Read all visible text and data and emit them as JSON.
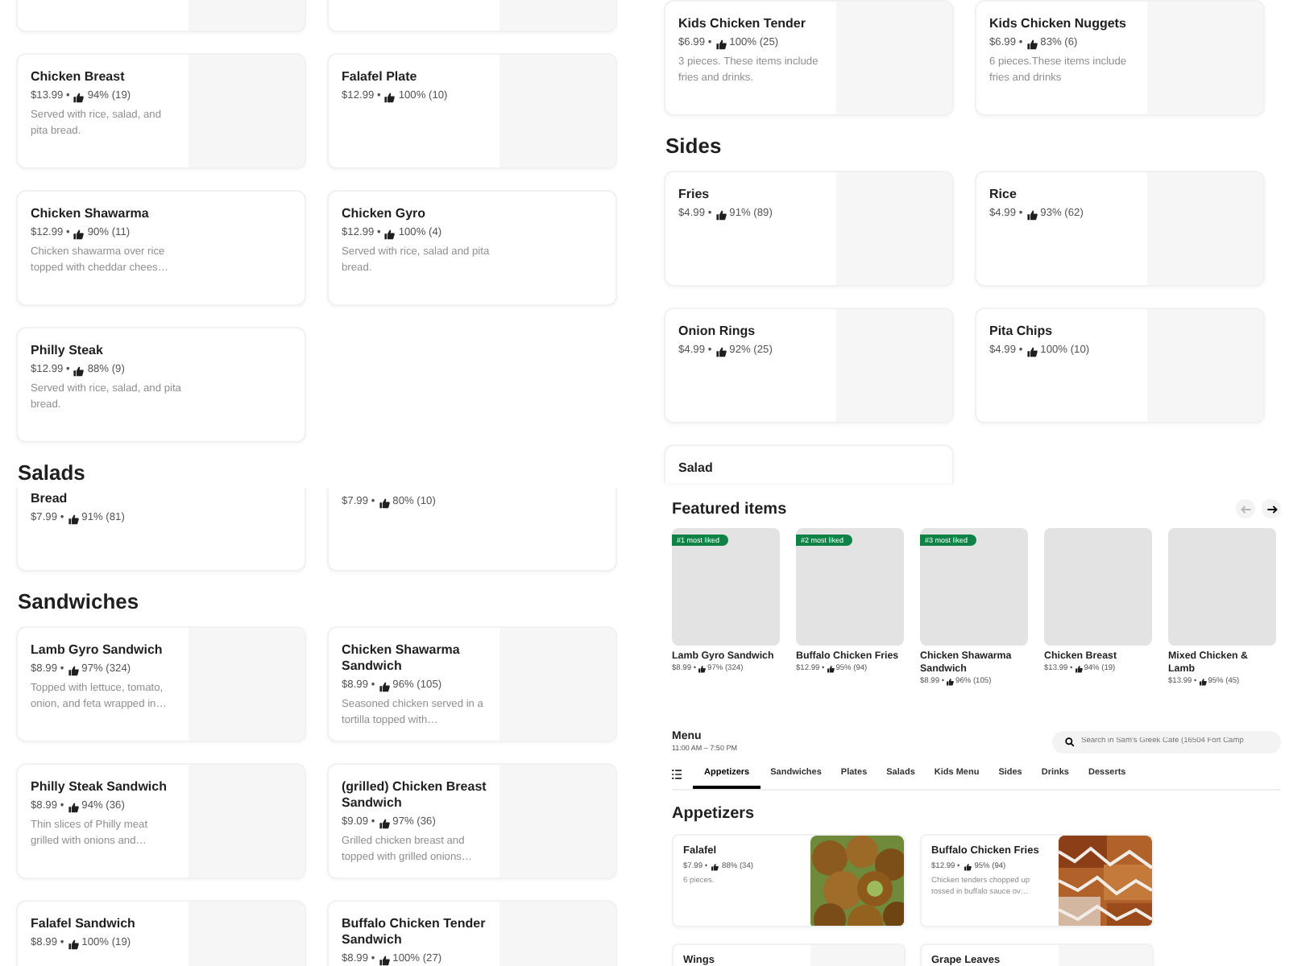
{
  "left_column": {
    "sections": [
      {
        "cards": [
          {
            "kind": "image_card"
          },
          {
            "kind": "image_card"
          },
          {
            "kind": "image_card",
            "title": "Chicken Breast",
            "price": "$13.99 •",
            "rating": "94% (19)",
            "description": "Served with rice, salad, and pita bread."
          },
          {
            "kind": "image_card",
            "title": "Falafel Plate",
            "price": "$12.99 •",
            "rating": "100% (10)"
          },
          {
            "kind": "text_card",
            "title": "Chicken Shawarma",
            "price": "$12.99 •",
            "rating": "90% (11)",
            "description": "Chicken shawarma over rice topped with cheddar chees…"
          },
          {
            "kind": "text_card",
            "title": "Chicken Gyro",
            "price": "$12.99 •",
            "rating": "100% (4)",
            "description": "Served with rice, salad and pita bread."
          },
          {
            "kind": "text_card",
            "title": "Philly Steak",
            "price": "$12.99 •",
            "rating": "88% (9)",
            "description": "Served with rice, salad, and pita bread."
          }
        ]
      },
      {
        "heading": "Salads",
        "cards": [
          {
            "kind": "cut_top",
            "title": "Bread",
            "price": "$7.99 •",
            "rating": "91% (81)"
          },
          {
            "kind": "cut_top",
            "price": "$7.99 •",
            "rating": "80% (10)"
          }
        ]
      },
      {
        "heading": "Sandwiches",
        "cards": [
          {
            "kind": "image_card",
            "title": "Lamb Gyro Sandwich",
            "price": "$8.99 •",
            "rating": "97% (324)",
            "description": "Topped with lettuce, tomato, onion, and feta wrapped in…"
          },
          {
            "kind": "image_card",
            "title": "Chicken Shawarma Sandwich",
            "price": "$8.99 •",
            "rating": "96% (105)",
            "description": "Seasoned chicken served in a tortilla topped with…"
          },
          {
            "kind": "image_card",
            "title": "Philly Steak Sandwich",
            "price": "$8.99 •",
            "rating": "94% (36)",
            "description": "Thin slices of Philly meat grilled with onions and…"
          },
          {
            "kind": "image_card",
            "title": "(grilled) Chicken Breast Sandwich",
            "price": "$9.09 •",
            "rating": "97% (36)",
            "description": "Grilled chicken breast and topped with grilled onions…"
          },
          {
            "kind": "image_card",
            "title": "Falafel Sandwich",
            "price": "$8.99 •",
            "rating": "100% (19)"
          },
          {
            "kind": "image_card",
            "title": "Buffalo Chicken Tender Sandwich",
            "price": "$8.99 •",
            "rating": "100% (27)"
          }
        ]
      }
    ]
  },
  "right_column": {
    "sections": [
      {
        "cards": [
          {
            "kind": "image_card",
            "title": "Kids Chicken Tender",
            "price": "$6.99 •",
            "rating": "100% (25)",
            "description": "3 pieces. These items include fries and drinks."
          },
          {
            "kind": "image_card",
            "title": "Kids Chicken Nuggets",
            "price": "$6.99 •",
            "rating": "83% (6)",
            "description": "6 pieces.These items include fries and drinks"
          }
        ]
      },
      {
        "heading": "Sides",
        "cards": [
          {
            "kind": "image_card",
            "title": "Fries",
            "price": "$4.99 •",
            "rating": "91% (89)"
          },
          {
            "kind": "image_card",
            "title": "Rice",
            "price": "$4.99 •",
            "rating": "93% (62)"
          },
          {
            "kind": "image_card",
            "title": "Onion Rings",
            "price": "$4.99 •",
            "rating": "92% (25)"
          },
          {
            "kind": "image_card",
            "title": "Pita Chips",
            "price": "$4.99 •",
            "rating": "100% (10)"
          },
          {
            "kind": "cut_bottom",
            "title": "Salad"
          }
        ]
      }
    ]
  },
  "featured": {
    "title": "Featured items",
    "carousel_buttons": [
      {
        "kind": "prev",
        "disabled": true
      },
      {
        "kind": "next",
        "disabled": false
      }
    ],
    "items": [
      {
        "badge": "#1 most liked",
        "name": "Lamb Gyro Sandwich",
        "price": "$8.99 •",
        "rating": "97% (324)"
      },
      {
        "badge": "#2 most liked",
        "name": "Buffalo Chicken Fries",
        "price": "$12.99 •",
        "rating": "95% (94)"
      },
      {
        "badge": "#3 most liked",
        "name": "Chicken Shawarma Sandwich",
        "price": "$8.99 •",
        "rating": "96% (105)"
      },
      {
        "name": "Chicken Breast",
        "price": "$13.99 •",
        "rating": "94% (19)"
      },
      {
        "name": "Mixed Chicken & Lamb",
        "price": "$13.99 •",
        "rating": "95% (45)"
      }
    ]
  },
  "menu": {
    "title": "Menu",
    "hours": "11:00 AM – 7:50 PM",
    "search": {
      "placeholder": "Search in Sam's Greek Cafe (16504 Fort Camp"
    },
    "tabs": [
      {
        "label": "Appetizers",
        "selected": true
      },
      {
        "label": "Sandwiches",
        "selected": false
      },
      {
        "label": "Plates",
        "selected": false
      },
      {
        "label": "Salads",
        "selected": false
      },
      {
        "label": "Kids Menu",
        "selected": false
      },
      {
        "label": "Sides",
        "selected": false
      },
      {
        "label": "Drinks",
        "selected": false
      },
      {
        "label": "Desserts",
        "selected": false
      }
    ]
  },
  "appetizers": {
    "heading": "Appetizers",
    "cards": [
      {
        "kind": "photo_card",
        "title": "Falafel",
        "price": "$7.99 •",
        "rating": "88% (34)",
        "description": "6 pieces."
      },
      {
        "kind": "photo_card",
        "title": "Buffalo Chicken Fries",
        "price": "$12.99 •",
        "rating": "95% (94)",
        "description": "Chicken tenders chopped up tossed in buffalo sauce ov…"
      },
      {
        "kind": "cut_bottom_image",
        "title": "Wings"
      },
      {
        "kind": "cut_bottom_image",
        "title": "Grape Leaves"
      }
    ]
  }
}
